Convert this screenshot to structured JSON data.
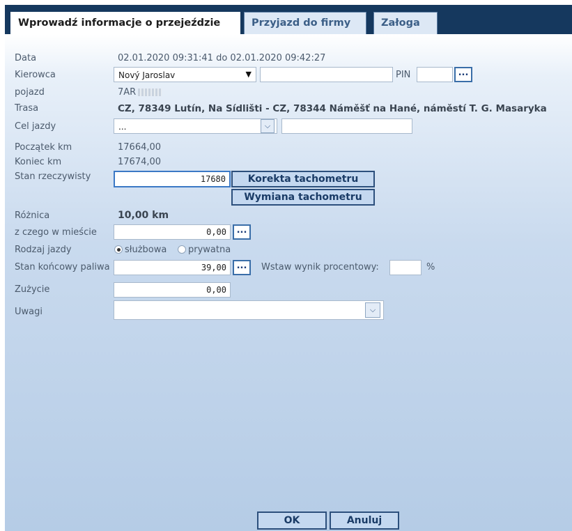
{
  "tabs": [
    {
      "label": "Wprowadź informacje o przejeździe",
      "active": true
    },
    {
      "label": "Przyjazd do firmy",
      "active": false
    },
    {
      "label": "Załoga",
      "active": false
    }
  ],
  "form": {
    "data": {
      "label": "Data",
      "value": "02.01.2020 09:31:41 do 02.01.2020 09:42:27"
    },
    "kierowca": {
      "label": "Kierowca",
      "select_value": "Nový Jaroslav",
      "text_value": "",
      "pin_label": "PIN",
      "pin_value": "",
      "dots": "..."
    },
    "pojazd": {
      "label": "pojazd",
      "value": "7AR"
    },
    "trasa": {
      "label": "Trasa",
      "value": "CZ, 78349 Lutín, Na Sídlišti - CZ, 78344 Náměšť na Hané, náměstí T. G. Masaryka"
    },
    "cel": {
      "label": "Cel jazdy",
      "select_value": "...",
      "text_value": ""
    },
    "poczatek": {
      "label": "Początek km",
      "value": "17664,00"
    },
    "koniec": {
      "label": "Koniec km",
      "value": "17674,00"
    },
    "stan": {
      "label": "Stan rzeczywisty",
      "value": "17680",
      "korekta_button": "Korekta tachometru",
      "wymiana_button": "Wymiana tachometru"
    },
    "roznica": {
      "label": "Różnica",
      "value": "10,00 km"
    },
    "w_miescie": {
      "label": "z czego w mieście",
      "value": "0,00",
      "dots": "..."
    },
    "rodzaj": {
      "label": "Rodzaj jazdy",
      "options": [
        "służbowa",
        "prywatna"
      ],
      "selected": "służbowa"
    },
    "paliwo": {
      "label": "Stan końcowy paliwa",
      "value": "39,00",
      "dots": "...",
      "procent_label": "Wstaw wynik procentowy:",
      "procent_value": "",
      "percent_sign": "%"
    },
    "zuzycie": {
      "label": "Zużycie",
      "value": "0,00"
    },
    "uwagi": {
      "label": "Uwagi",
      "value": ""
    }
  },
  "footer": {
    "ok": "OK",
    "cancel": "Anuluj"
  },
  "colors": {
    "header": "#15385e",
    "button_bg": "#c4d8f0",
    "button_border": "#2c4f7c"
  }
}
